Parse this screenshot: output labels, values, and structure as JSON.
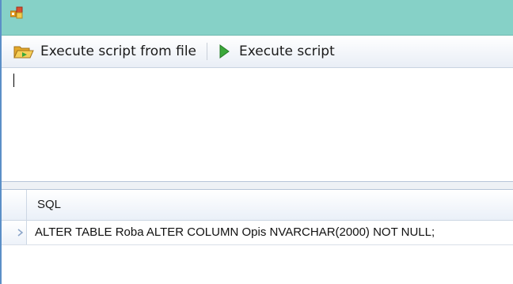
{
  "toolbar": {
    "execute_from_file_label": "Execute script from file",
    "execute_label": "Execute script"
  },
  "editor": {
    "content": ""
  },
  "results": {
    "columns": [
      "SQL"
    ],
    "rows": [
      [
        "ALTER TABLE Roba ALTER COLUMN Opis NVARCHAR(2000) NOT NULL;"
      ]
    ]
  },
  "colors": {
    "titlebar": "#86d1c7",
    "border": "#5b8fc7",
    "run_arrow": "#3aa83a"
  },
  "icons": {
    "app": "app-window-icon",
    "open_script": "folder-open-icon",
    "run": "play-icon",
    "row_indicator": "row-pointer-icon"
  }
}
